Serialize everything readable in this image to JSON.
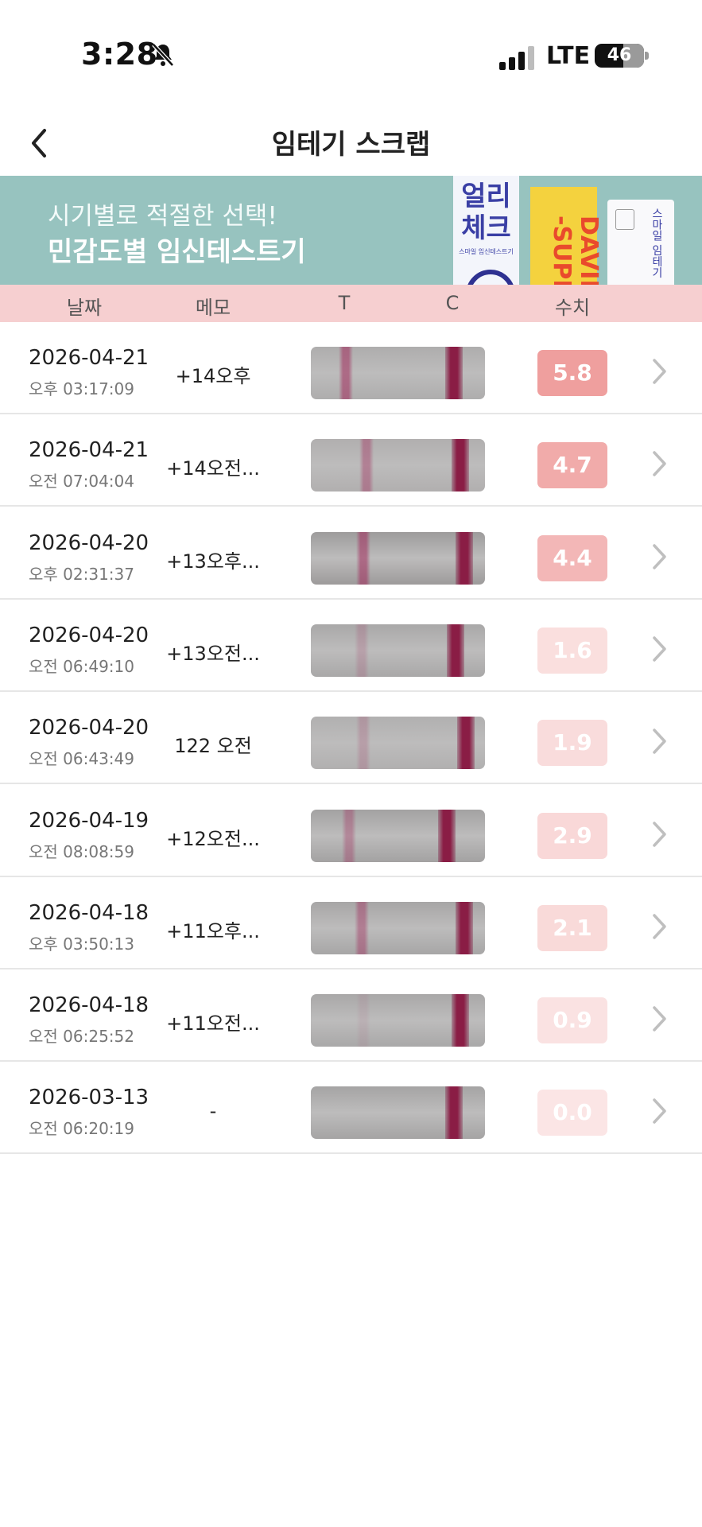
{
  "status_bar": {
    "time": "3:28",
    "carrier": "LTE",
    "battery": "46",
    "icons": [
      "bell-muted-icon",
      "signal-bars-icon",
      "battery-icon"
    ]
  },
  "nav": {
    "title": "임테기 스크랩",
    "back_icon": "chevron-left-icon"
  },
  "banner": {
    "line1": "시기별로 적절한 선택!",
    "line2": "민감도별 임신테스트기",
    "product1_line1": "얼리",
    "product1_line2": "체크",
    "product1_sub": "스마일 임신테스트기",
    "product2_text": "DAVID -SUPE",
    "product3_text": "스마일 임테기"
  },
  "table_header": {
    "date": "날짜",
    "memo": "메모",
    "t": "T",
    "c": "C",
    "value": "수치"
  },
  "colors": {
    "header_bg": "#f6cfd0",
    "banner_bg": "#97c3bf",
    "value_base": "#ef9f9e",
    "line_dark": "#8a1d45"
  },
  "records": [
    {
      "date": "2026-04-21",
      "time": "오후 03:17:09",
      "memo": "+14오후",
      "value": "5.8",
      "value_level": 1.0,
      "t_pos": 0.2,
      "c_pos": 0.82,
      "t_intensity": 0.55,
      "strip_tint": "#aeadad"
    },
    {
      "date": "2026-04-21",
      "time": "오전 07:04:04",
      "memo": "+14오전...",
      "value": "4.7",
      "value_level": 0.85,
      "t_pos": 0.32,
      "c_pos": 0.86,
      "t_intensity": 0.4,
      "strip_tint": "#b1afaf"
    },
    {
      "date": "2026-04-20",
      "time": "오후 02:31:37",
      "memo": "+13오후...",
      "value": "4.4",
      "value_level": 0.7,
      "t_pos": 0.3,
      "c_pos": 0.88,
      "t_intensity": 0.55,
      "strip_tint": "#9d9b9b"
    },
    {
      "date": "2026-04-20",
      "time": "오전 06:49:10",
      "memo": "+13오전...",
      "value": "1.6",
      "value_level": 0.22,
      "t_pos": 0.29,
      "c_pos": 0.83,
      "t_intensity": 0.18,
      "strip_tint": "#a9a8a8"
    },
    {
      "date": "2026-04-20",
      "time": "오전 06:43:49",
      "memo": "122 오전",
      "value": "1.9",
      "value_level": 0.25,
      "t_pos": 0.3,
      "c_pos": 0.89,
      "t_intensity": 0.2,
      "strip_tint": "#b1b0b0"
    },
    {
      "date": "2026-04-19",
      "time": "오전 08:08:59",
      "memo": "+12오전...",
      "value": "2.9",
      "value_level": 0.3,
      "t_pos": 0.22,
      "c_pos": 0.78,
      "t_intensity": 0.35,
      "strip_tint": "#a3a2a2"
    },
    {
      "date": "2026-04-18",
      "time": "오후 03:50:13",
      "memo": "+11오후...",
      "value": "2.1",
      "value_level": 0.28,
      "t_pos": 0.29,
      "c_pos": 0.88,
      "t_intensity": 0.42,
      "strip_tint": "#a7a6a6"
    },
    {
      "date": "2026-04-18",
      "time": "오전 06:25:52",
      "memo": "+11오전...",
      "value": "0.9",
      "value_level": 0.18,
      "t_pos": 0.3,
      "c_pos": 0.86,
      "t_intensity": 0.08,
      "strip_tint": "#a9a8a8"
    },
    {
      "date": "2026-03-13",
      "time": "오전 06:20:19",
      "memo": "-",
      "value": "0.0",
      "value_level": 0.14,
      "t_pos": 0.3,
      "c_pos": 0.82,
      "t_intensity": 0.0,
      "strip_tint": "#a5a4a4"
    }
  ]
}
